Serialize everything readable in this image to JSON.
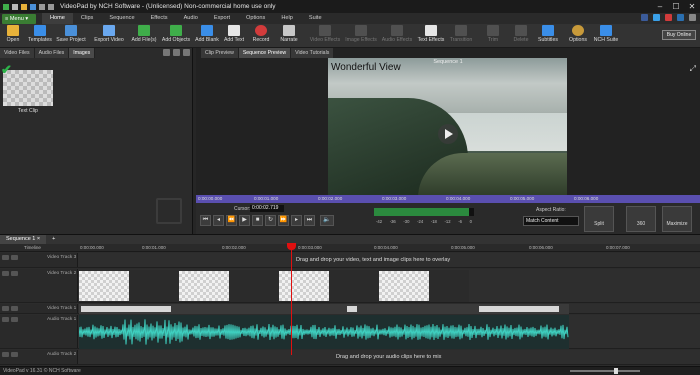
{
  "app": {
    "title": "VideoPad by NCH Software - (Unlicensed) Non-commercial home use only",
    "window_controls": [
      "–",
      "☐",
      "✕"
    ]
  },
  "menu": {
    "menu_button": "≡ Menu ▾",
    "tabs": [
      "Home",
      "Clips",
      "Sequence",
      "Effects",
      "Audio",
      "Export",
      "Options",
      "Help",
      "Suite"
    ],
    "active_tab": "Home"
  },
  "toolbar": {
    "items": [
      {
        "label": "Open",
        "icon": "folder-icon",
        "color": "#e8b23a",
        "enabled": true
      },
      {
        "label": "Templates",
        "icon": "templates-icon",
        "color": "#3a8ee8",
        "enabled": true
      },
      {
        "label": "Save Project",
        "icon": "save-icon",
        "color": "#4a90d9",
        "enabled": true
      },
      {
        "label": "Export Video",
        "icon": "export-video-icon",
        "color": "#6aa8ef",
        "enabled": true
      },
      {
        "label": "Add File(s)",
        "icon": "add-files-icon",
        "color": "#3fae4a",
        "enabled": true
      },
      {
        "label": "Add Objects",
        "icon": "add-objects-icon",
        "color": "#3fae4a",
        "enabled": true
      },
      {
        "label": "Add Blank",
        "icon": "add-blank-icon",
        "color": "#3a8ee8",
        "enabled": true
      },
      {
        "label": "Add Text",
        "icon": "add-text-icon",
        "color": "#e6e6e6",
        "enabled": true
      },
      {
        "label": "Record",
        "icon": "record-icon",
        "color": "#d23b3b",
        "enabled": true
      },
      {
        "label": "Narrate",
        "icon": "microphone-icon",
        "color": "#c8c8c8",
        "enabled": true
      },
      {
        "label": "Video Effects",
        "icon": "video-effects-icon",
        "color": "#888888",
        "enabled": false
      },
      {
        "label": "Image Effects",
        "icon": "image-effects-icon",
        "color": "#888888",
        "enabled": false
      },
      {
        "label": "Audio Effects",
        "icon": "audio-effects-icon",
        "color": "#888888",
        "enabled": false
      },
      {
        "label": "Text Effects",
        "icon": "text-effects-icon",
        "color": "#e6e6e6",
        "enabled": true
      },
      {
        "label": "Transition",
        "icon": "transition-icon",
        "color": "#888888",
        "enabled": false
      },
      {
        "label": "Trim",
        "icon": "trim-icon",
        "color": "#888888",
        "enabled": false
      },
      {
        "label": "Delete",
        "icon": "delete-icon",
        "color": "#888888",
        "enabled": false
      },
      {
        "label": "Subtitles",
        "icon": "subtitles-icon",
        "color": "#3a8ee8",
        "enabled": true
      },
      {
        "label": "Options",
        "icon": "gear-icon",
        "color": "#c89a3a",
        "enabled": true
      },
      {
        "label": "NCH Suite",
        "icon": "nch-suite-icon",
        "color": "#3a8ee8",
        "enabled": true
      }
    ],
    "buy_online": "Buy Online"
  },
  "bins": {
    "tabs": [
      "Video Files",
      "Audio Files",
      "Images"
    ],
    "active_tab": "Images",
    "clip_label": "Text Clip"
  },
  "preview": {
    "tabs": [
      "Clip Preview",
      "Sequence Preview",
      "Video Tutorials"
    ],
    "active_tab": "Sequence Preview",
    "sequence_title": "Sequence 1",
    "overlay_text": "Wonderful View",
    "ruler_labels": [
      "0:00:00.000",
      "0:00:01.000",
      "0:00:02.000",
      "0:00:03.000",
      "0:00:04.000",
      "0:00:05.000",
      "0:00:06.000"
    ],
    "cursor_label": "Cursor:",
    "cursor_value": "0:00:02.719",
    "meter_labels": [
      "-42",
      "-36",
      "-30",
      "-24",
      "-18",
      "-12",
      "-6",
      "0"
    ],
    "meter_level": 0.95,
    "aspect_label": "Aspect Ratio:",
    "aspect_value": "Match Content",
    "split_label": "Split",
    "view360_label": "360",
    "maximize_label": "Maximize"
  },
  "timeline": {
    "sequence_tab": "Sequence 1 ×",
    "add_tab": "+",
    "ruler_title": "Timeline",
    "ruler_labels": [
      "0:00:00.000",
      "0:00:01.000",
      "0:00:02.000",
      "0:00:03.000",
      "0:00:04.000",
      "0:00:05.000",
      "0:00:06.000",
      "0:00:07.000"
    ],
    "tracks": [
      {
        "name": "Video Track 3",
        "hint": "Drag and drop your video, text and image clips here to overlay"
      },
      {
        "name": "Video Track 2",
        "hint": ""
      },
      {
        "name": "Video Track 1",
        "hint": ""
      },
      {
        "name": "Audio Track 1",
        "hint": ""
      },
      {
        "name": "Audio Track 2",
        "hint": "Drag and drop your audio clips here to mix"
      }
    ]
  },
  "status": {
    "version": "VideoPad v 16.31 © NCH Software"
  }
}
